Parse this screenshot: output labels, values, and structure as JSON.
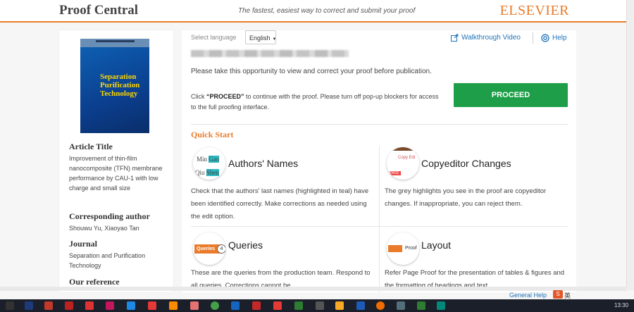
{
  "header": {
    "brand": "Proof Central",
    "tagline": "The fastest, easiest way to correct and submit your proof",
    "publisher": "ELSEVIER"
  },
  "sidebar": {
    "cover": {
      "title_line1": "Separation",
      "title_line2": "Purification",
      "title_line3": "Technology",
      "colors": {
        "background": "#0d56a8",
        "title": "#ffd800"
      }
    },
    "article_title_heading": "Article Title",
    "article_title": "Improvement of thin-film nanocomposite (TFN) membrane performance by CAU-1 with low charge and small size",
    "corresponding_author_heading": "Corresponding author",
    "corresponding_author": "Shouwu Yu, Xiaoyao Tan",
    "journal_heading": "Journal",
    "journal": "Separation and Purification Technology",
    "reference_heading": "Our reference"
  },
  "topbar": {
    "language_label": "Select language",
    "language_value": "English",
    "walkthrough_label": "Walkthrough Video",
    "help_label": "Help"
  },
  "intro": {
    "message": "Please take this opportunity to view and correct your proof before publication.",
    "click_bold": "“PROCEED”",
    "click_prefix": "Click ",
    "click_suffix": " to continue with the proof. Please turn off pop-up blockers for access to the full proofing interface.",
    "proceed_label": "PROCEED"
  },
  "quick_start": {
    "title": "Quick Start",
    "cards": [
      {
        "title": "Authors' Names",
        "text": "Check that the authors' last names (highlighted in teal) have been identified correctly. Make corrections as needed using the edit option.",
        "icon_line1_a": "Min",
        "icon_line1_b": "Gao",
        "icon_line2_a": "Qiu",
        "icon_line2_b": "Shen"
      },
      {
        "title": "Copyeditor Changes",
        "text": "The grey highlights you see in the proof are copyeditor changes. If inappropriate, you can reject them.",
        "icon_text": "Copy Edi",
        "icon_text2": "PAGE"
      },
      {
        "title": "Queries",
        "text": "These are the queries from the production team. Respond to all queries. Corrections cannot be",
        "icon_label": "Queries",
        "icon_count": "4"
      },
      {
        "title": "Layout",
        "text": "Refer Page Proof for the presentation of tables & figures and the formatting of headings and text",
        "icon_text": "Proof"
      }
    ]
  },
  "footer": {
    "general_help": "General Help",
    "ime_logo": "S",
    "ime_text": "英",
    "clock": "13:30"
  },
  "colors": {
    "accent": "#ea7b2a",
    "proceed": "#1e9e48",
    "link": "#1f73b8",
    "highlight": "#2bb8c0"
  }
}
